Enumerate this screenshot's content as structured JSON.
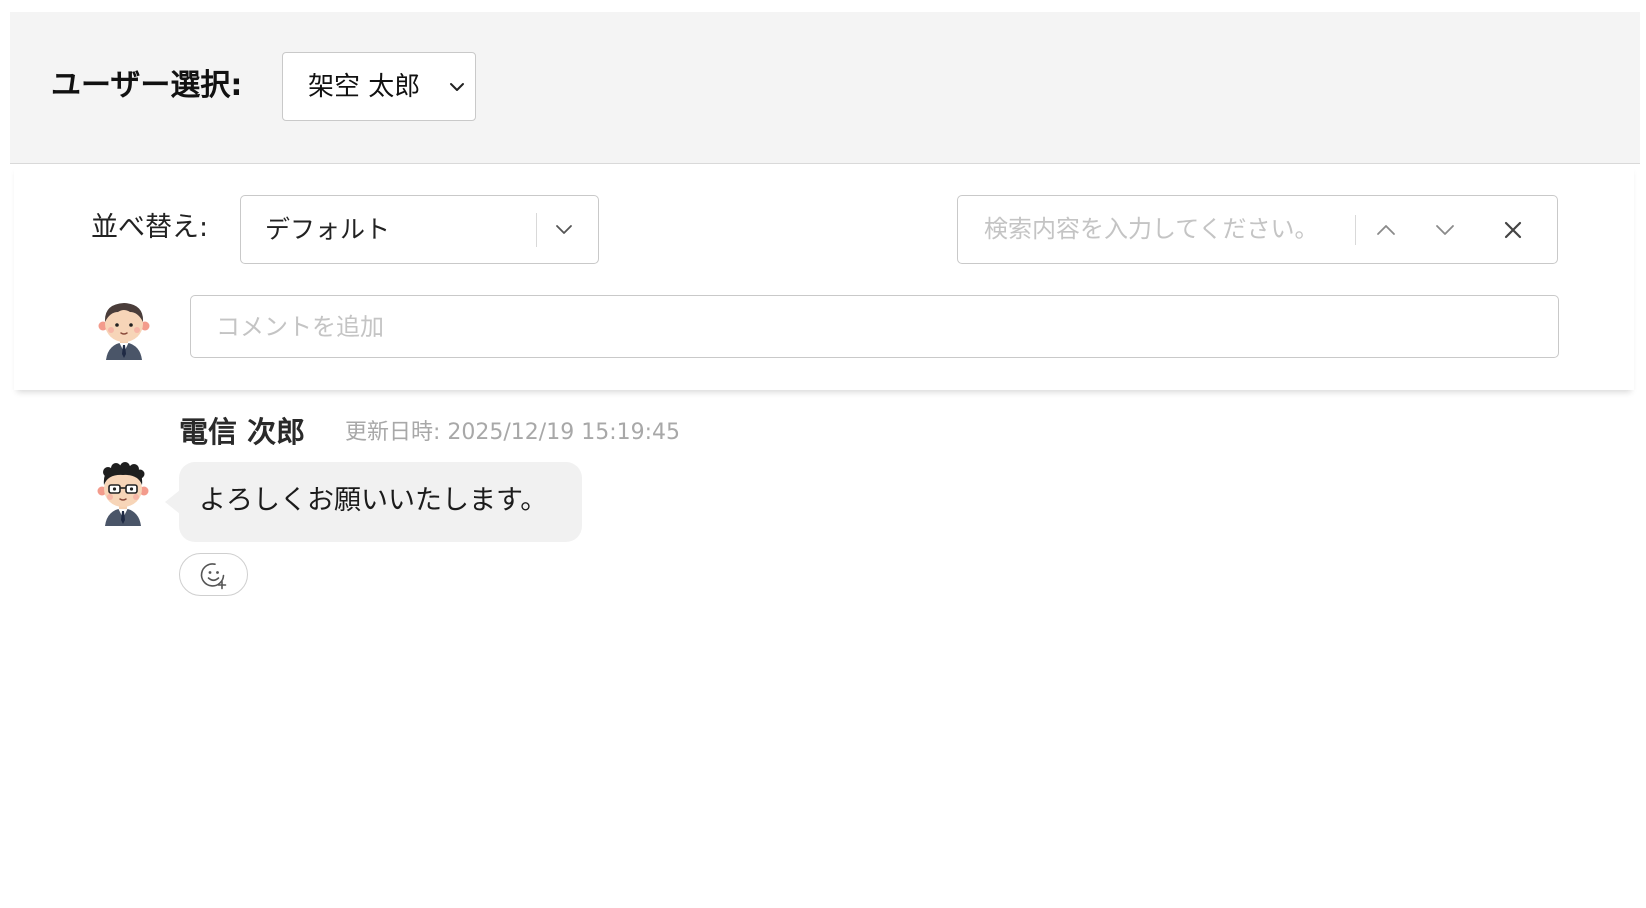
{
  "user_select": {
    "label": "ユーザー選択:",
    "value": "架空 太郎",
    "icon": "chevron-down-icon"
  },
  "toolbar": {
    "sort_label": "並べ替え:",
    "sort_value": "デフォルト",
    "search_placeholder": "検索内容を入力してください。",
    "search_prev_icon": "chevron-up-icon",
    "search_next_icon": "chevron-down-icon",
    "search_clear_icon": "close-icon"
  },
  "composer": {
    "placeholder": "コメントを追加",
    "avatar": "user-avatar-icon"
  },
  "comments": [
    {
      "author": "電信 次郎",
      "updated": "更新日時: 2025/12/19 15:19:45",
      "text": "よろしくお願いいたします。",
      "avatar": "user-avatar-glasses-icon",
      "reaction_icon": "add-reaction-icon"
    }
  ],
  "colors": {
    "header_bg": "#f4f4f4",
    "border": "#c9c9c9",
    "bubble_bg": "#f1f1f1",
    "placeholder": "#c4c4c4",
    "meta_text": "#a8a8a8"
  }
}
